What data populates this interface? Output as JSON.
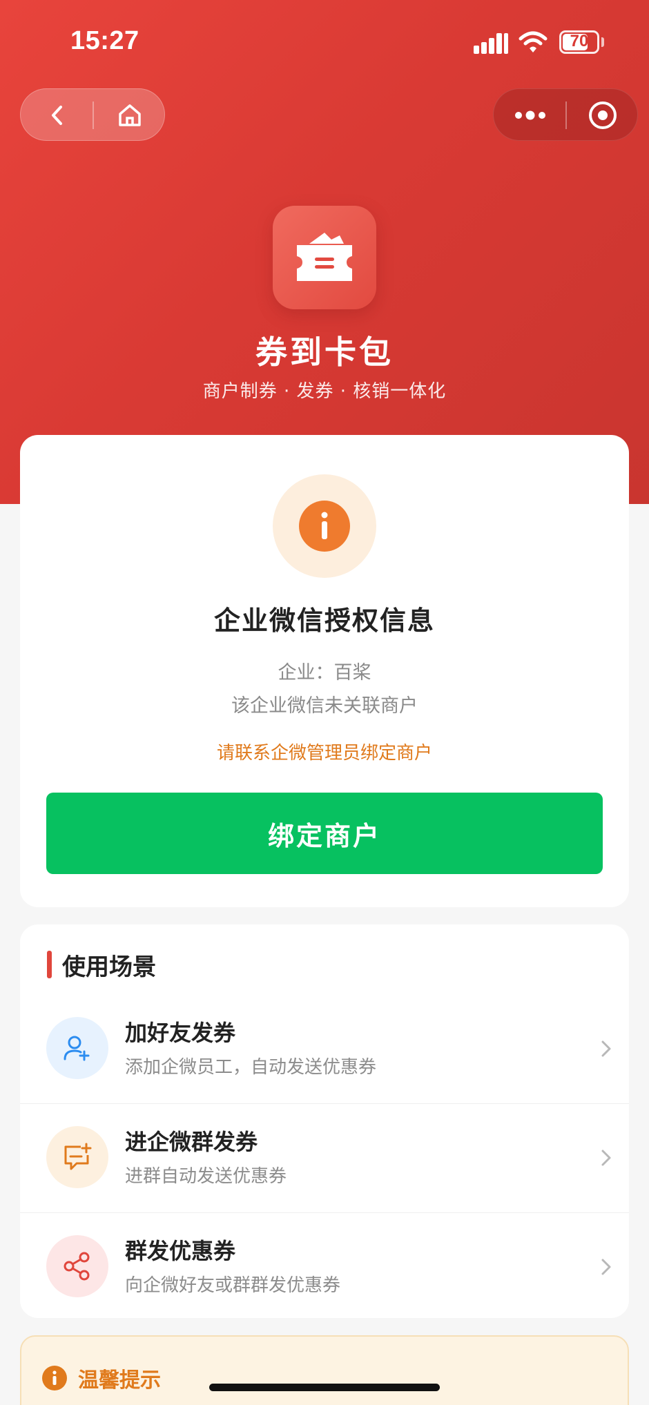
{
  "status_bar": {
    "time": "15:27",
    "battery": "70",
    "icons": [
      "signal-icon",
      "wifi-icon",
      "battery-icon"
    ]
  },
  "nav": {
    "left": [
      "back-icon",
      "home-icon"
    ],
    "right": [
      "more-icon",
      "capsule-close-icon"
    ]
  },
  "app": {
    "name": "券到卡包",
    "tagline": "商户制券 · 发券 · 核销一体化",
    "logo_icon": "coupon-wallet-icon"
  },
  "auth": {
    "title": "企业微信授权信息",
    "company": "企业：百桨",
    "status": "该企业微信未关联商户",
    "hint": "请联系企微管理员绑定商户",
    "button_label": "绑定商户"
  },
  "scenes": {
    "section_title": "使用场景",
    "items": [
      {
        "icon": "add-friend-icon",
        "title": "加好友发券",
        "desc": "添加企微员工，自动发送优惠券"
      },
      {
        "icon": "group-chat-add-icon",
        "title": "进企微群发券",
        "desc": "进群自动发送优惠券"
      },
      {
        "icon": "share-icon",
        "title": "群发优惠券",
        "desc": "向企微好友或群群发优惠券"
      }
    ]
  },
  "tips": {
    "title": "温馨提示"
  },
  "colors": {
    "brand_red": "#d93a34",
    "primary_green": "#07c160",
    "warning_orange": "#e07a1c",
    "blue": "#2b8cf0",
    "red_light": "#fde6e6"
  }
}
